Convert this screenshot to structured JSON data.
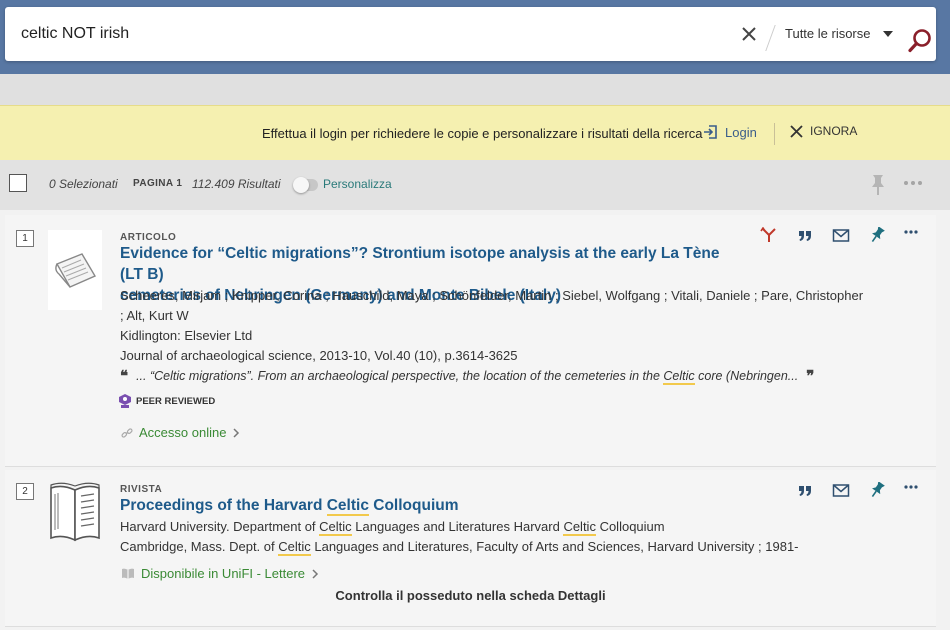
{
  "search": {
    "query": "celtic NOT irish",
    "scope": "Tutte le risorse"
  },
  "notice": {
    "text": "Effettua il login per richiedere le copie e personalizzare i risultati della ricerca",
    "login_label": "Login",
    "ignore_label": "IGNORA"
  },
  "toolbar": {
    "selected": "0 Selezionati",
    "page": "PAGINA 1",
    "results": "112.409 Risultati",
    "personalize_label": "Personalizza",
    "personalize_on": false
  },
  "results": [
    {
      "index": "1",
      "type": "ARTICOLO",
      "title_line1": "Evidence for “Celtic migrations”? Strontium isotope analysis at the early La Tène (LT B)",
      "title_line2": "cemeteries of Nebringen (Germany) and Monte Bibele (Italy)",
      "authors_line1": "Scheeres, Mirjam ; Knipper, Corina ; Hauschild, Maya ; Schönfelder, Martin ; Siebel, Wolfgang ; Vitali, Daniele ; Pare, Christopher",
      "authors_line2": "; Alt, Kurt W",
      "publisher": "Kidlington: Elsevier Ltd",
      "source": "Journal of archaeological science, 2013-10, Vol.40 (10), p.3614-3625",
      "snippet_before": "... “Celtic migrations”. From an archaeological perspective, the location of the cemeteries in the ",
      "snippet_highlight": "Celtic",
      "snippet_after": " core (Nebringen...",
      "peer_reviewed": "PEER REVIEWED",
      "access_label": "Accesso online"
    },
    {
      "index": "2",
      "type": "RIVISTA",
      "title_before": "Proceedings of the Harvard ",
      "title_highlight": "Celtic",
      "title_after": " Colloquium",
      "line1_a": "Harvard University. Department of ",
      "line1_hl1": "Celtic",
      "line1_b": " Languages and Literatures Harvard ",
      "line1_hl2": "Celtic",
      "line1_c": " Colloquium",
      "line2_a": "Cambridge, Mass. Dept. of ",
      "line2_hl": "Celtic",
      "line2_b": " Languages and Literatures, Faculty of Arts and Sciences, Harvard University ; 1981-",
      "availability_label": "Disponibile in UniFI - Lettere",
      "holdings_note": "Controlla il posseduto nella scheda Dettagli"
    }
  ],
  "colors": {
    "header_blue": "#5877a3",
    "notice_yellow": "#f5f0b0",
    "title_blue": "#1e5a8a",
    "access_green": "#3a8a35",
    "highlight": "#f2c94c",
    "teal_pin": "#2a7a7a"
  }
}
